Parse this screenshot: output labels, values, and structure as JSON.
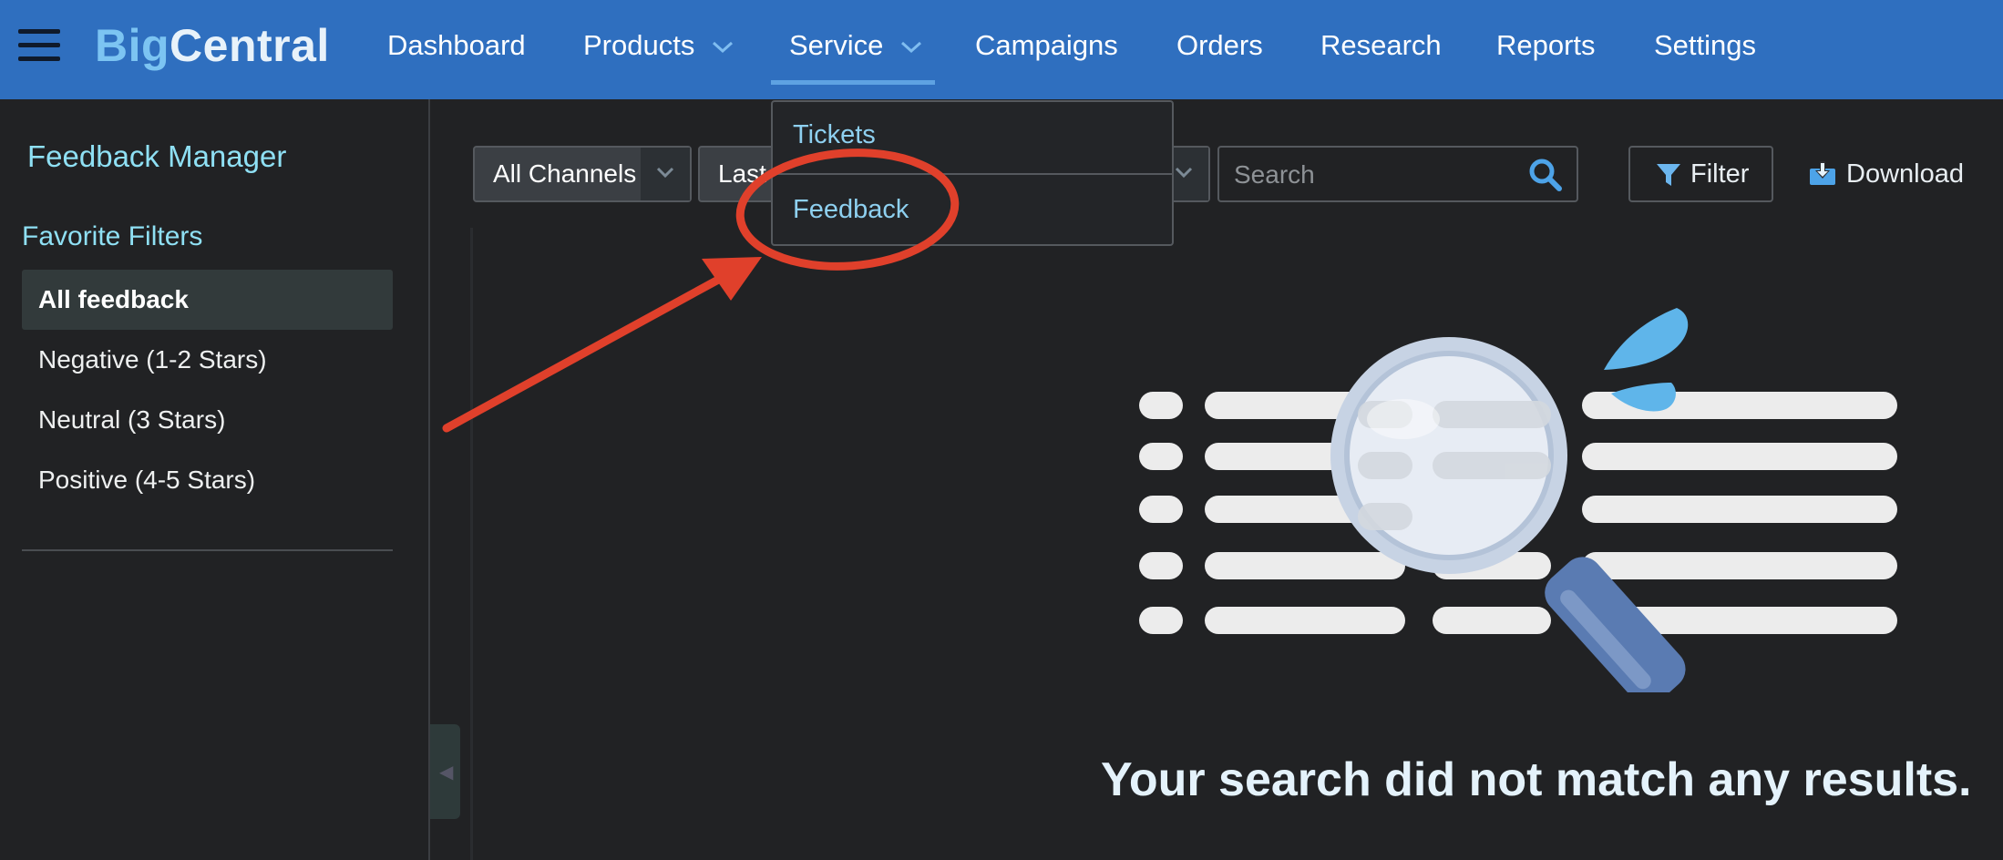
{
  "app": {
    "logo_part1": "Big",
    "logo_part2": "Central"
  },
  "nav": {
    "dashboard": "Dashboard",
    "products": "Products",
    "service": "Service",
    "campaigns": "Campaigns",
    "orders": "Orders",
    "research": "Research",
    "reports": "Reports",
    "settings": "Settings"
  },
  "service_menu": {
    "tickets": "Tickets",
    "feedback": "Feedback"
  },
  "sidebar": {
    "title": "Feedback Manager",
    "section": "Favorite Filters",
    "items": [
      {
        "label": "All feedback",
        "active": true
      },
      {
        "label": "Negative (1-2 Stars)",
        "active": false
      },
      {
        "label": "Neutral (3 Stars)",
        "active": false
      },
      {
        "label": "Positive (4-5 Stars)",
        "active": false
      }
    ]
  },
  "toolbar": {
    "channels_value": "All Channels",
    "date_value_visible": "Last",
    "search_placeholder": "Search",
    "filter_label": "Filter",
    "download_label": "Download"
  },
  "empty_state": {
    "message": "Your search did not match any results."
  },
  "colors": {
    "topbar": "#2f6fbf",
    "background": "#212224",
    "accent_text": "#8fe0f4",
    "annotation": "#e0402b"
  },
  "icons": [
    "hamburger-icon",
    "chevron-down-icon",
    "search-icon",
    "filter-icon",
    "download-icon",
    "collapse-icon"
  ]
}
